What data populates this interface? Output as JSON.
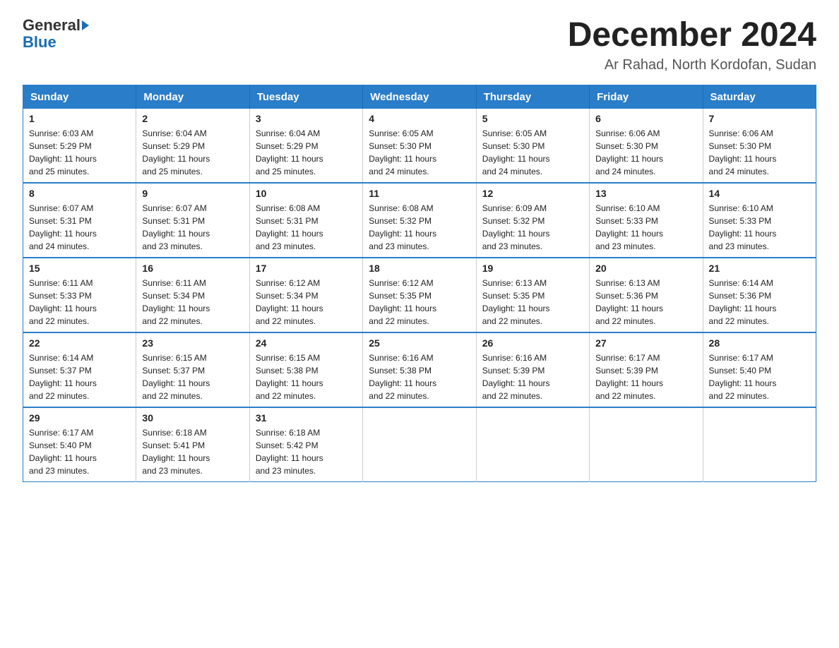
{
  "logo": {
    "text_general": "General",
    "text_blue": "Blue"
  },
  "title": "December 2024",
  "subtitle": "Ar Rahad, North Kordofan, Sudan",
  "days_of_week": [
    "Sunday",
    "Monday",
    "Tuesday",
    "Wednesday",
    "Thursday",
    "Friday",
    "Saturday"
  ],
  "weeks": [
    [
      {
        "day": "1",
        "sunrise": "6:03 AM",
        "sunset": "5:29 PM",
        "daylight": "11 hours and 25 minutes."
      },
      {
        "day": "2",
        "sunrise": "6:04 AM",
        "sunset": "5:29 PM",
        "daylight": "11 hours and 25 minutes."
      },
      {
        "day": "3",
        "sunrise": "6:04 AM",
        "sunset": "5:29 PM",
        "daylight": "11 hours and 25 minutes."
      },
      {
        "day": "4",
        "sunrise": "6:05 AM",
        "sunset": "5:30 PM",
        "daylight": "11 hours and 24 minutes."
      },
      {
        "day": "5",
        "sunrise": "6:05 AM",
        "sunset": "5:30 PM",
        "daylight": "11 hours and 24 minutes."
      },
      {
        "day": "6",
        "sunrise": "6:06 AM",
        "sunset": "5:30 PM",
        "daylight": "11 hours and 24 minutes."
      },
      {
        "day": "7",
        "sunrise": "6:06 AM",
        "sunset": "5:30 PM",
        "daylight": "11 hours and 24 minutes."
      }
    ],
    [
      {
        "day": "8",
        "sunrise": "6:07 AM",
        "sunset": "5:31 PM",
        "daylight": "11 hours and 24 minutes."
      },
      {
        "day": "9",
        "sunrise": "6:07 AM",
        "sunset": "5:31 PM",
        "daylight": "11 hours and 23 minutes."
      },
      {
        "day": "10",
        "sunrise": "6:08 AM",
        "sunset": "5:31 PM",
        "daylight": "11 hours and 23 minutes."
      },
      {
        "day": "11",
        "sunrise": "6:08 AM",
        "sunset": "5:32 PM",
        "daylight": "11 hours and 23 minutes."
      },
      {
        "day": "12",
        "sunrise": "6:09 AM",
        "sunset": "5:32 PM",
        "daylight": "11 hours and 23 minutes."
      },
      {
        "day": "13",
        "sunrise": "6:10 AM",
        "sunset": "5:33 PM",
        "daylight": "11 hours and 23 minutes."
      },
      {
        "day": "14",
        "sunrise": "6:10 AM",
        "sunset": "5:33 PM",
        "daylight": "11 hours and 23 minutes."
      }
    ],
    [
      {
        "day": "15",
        "sunrise": "6:11 AM",
        "sunset": "5:33 PM",
        "daylight": "11 hours and 22 minutes."
      },
      {
        "day": "16",
        "sunrise": "6:11 AM",
        "sunset": "5:34 PM",
        "daylight": "11 hours and 22 minutes."
      },
      {
        "day": "17",
        "sunrise": "6:12 AM",
        "sunset": "5:34 PM",
        "daylight": "11 hours and 22 minutes."
      },
      {
        "day": "18",
        "sunrise": "6:12 AM",
        "sunset": "5:35 PM",
        "daylight": "11 hours and 22 minutes."
      },
      {
        "day": "19",
        "sunrise": "6:13 AM",
        "sunset": "5:35 PM",
        "daylight": "11 hours and 22 minutes."
      },
      {
        "day": "20",
        "sunrise": "6:13 AM",
        "sunset": "5:36 PM",
        "daylight": "11 hours and 22 minutes."
      },
      {
        "day": "21",
        "sunrise": "6:14 AM",
        "sunset": "5:36 PM",
        "daylight": "11 hours and 22 minutes."
      }
    ],
    [
      {
        "day": "22",
        "sunrise": "6:14 AM",
        "sunset": "5:37 PM",
        "daylight": "11 hours and 22 minutes."
      },
      {
        "day": "23",
        "sunrise": "6:15 AM",
        "sunset": "5:37 PM",
        "daylight": "11 hours and 22 minutes."
      },
      {
        "day": "24",
        "sunrise": "6:15 AM",
        "sunset": "5:38 PM",
        "daylight": "11 hours and 22 minutes."
      },
      {
        "day": "25",
        "sunrise": "6:16 AM",
        "sunset": "5:38 PM",
        "daylight": "11 hours and 22 minutes."
      },
      {
        "day": "26",
        "sunrise": "6:16 AM",
        "sunset": "5:39 PM",
        "daylight": "11 hours and 22 minutes."
      },
      {
        "day": "27",
        "sunrise": "6:17 AM",
        "sunset": "5:39 PM",
        "daylight": "11 hours and 22 minutes."
      },
      {
        "day": "28",
        "sunrise": "6:17 AM",
        "sunset": "5:40 PM",
        "daylight": "11 hours and 22 minutes."
      }
    ],
    [
      {
        "day": "29",
        "sunrise": "6:17 AM",
        "sunset": "5:40 PM",
        "daylight": "11 hours and 23 minutes."
      },
      {
        "day": "30",
        "sunrise": "6:18 AM",
        "sunset": "5:41 PM",
        "daylight": "11 hours and 23 minutes."
      },
      {
        "day": "31",
        "sunrise": "6:18 AM",
        "sunset": "5:42 PM",
        "daylight": "11 hours and 23 minutes."
      },
      null,
      null,
      null,
      null
    ]
  ],
  "labels": {
    "sunrise": "Sunrise:",
    "sunset": "Sunset:",
    "daylight": "Daylight:"
  }
}
